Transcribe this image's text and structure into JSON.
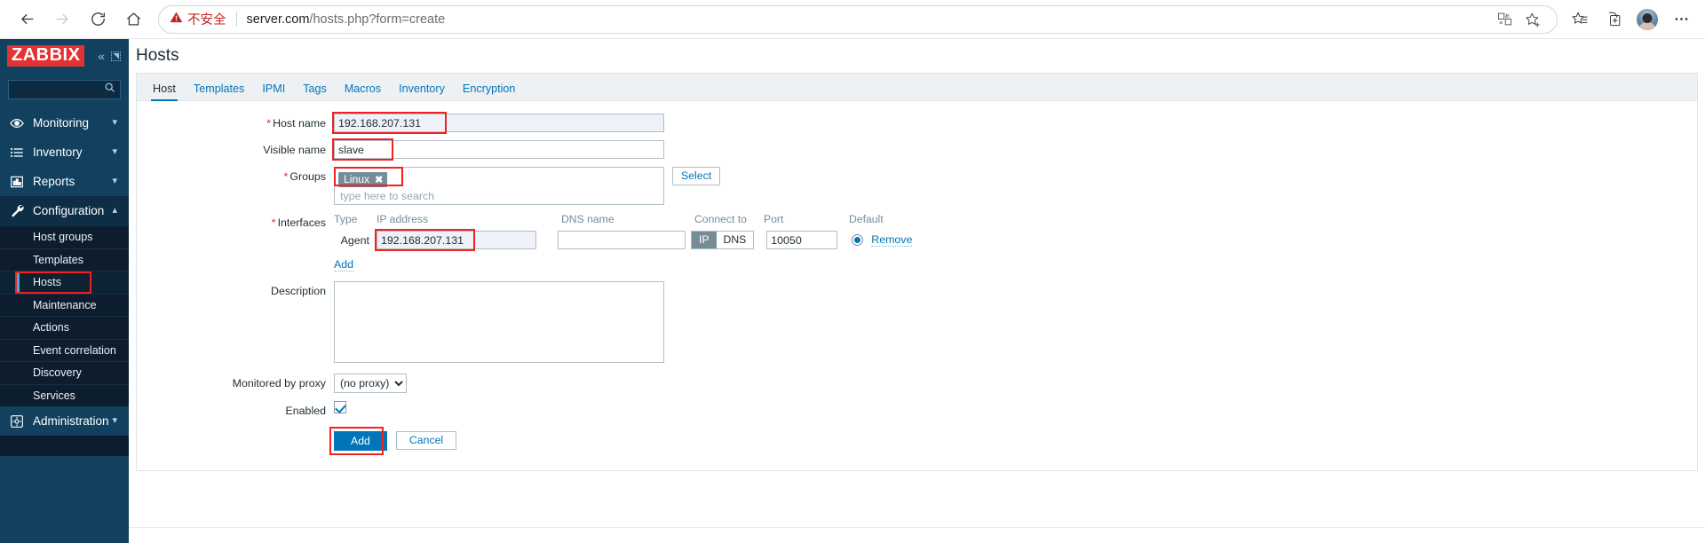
{
  "browser": {
    "back_icon": "arrow-left-icon",
    "forward_icon": "arrow-right-icon",
    "reload_icon": "reload-icon",
    "home_icon": "home-icon",
    "security_warning": "不安全",
    "warning_icon": "warning-triangle-icon",
    "url_host": "server.com",
    "url_path": "/hosts.php?form=create",
    "omnibox_icons": [
      "translate-ime-icon",
      "favorite-star-icon"
    ],
    "toolbar_icons": [
      "collections-icon",
      "split-screen-icon",
      "profile-avatar",
      "more-options-icon"
    ]
  },
  "sidebar": {
    "logo": "ZABBIX",
    "collapse_icon": "chevron-double-left-icon",
    "expand_icon": "expand-panel-icon",
    "search_placeholder": "",
    "search_icon": "search-icon",
    "items": [
      {
        "label": "Monitoring",
        "icon": "eye-icon",
        "caret": "chevron-down-icon"
      },
      {
        "label": "Inventory",
        "icon": "list-icon",
        "caret": "chevron-down-icon"
      },
      {
        "label": "Reports",
        "icon": "bar-chart-icon",
        "caret": "chevron-down-icon"
      },
      {
        "label": "Configuration",
        "icon": "wrench-icon",
        "caret": "chevron-up-icon"
      }
    ],
    "sub_items": [
      {
        "label": "Host groups"
      },
      {
        "label": "Templates"
      },
      {
        "label": "Hosts"
      },
      {
        "label": "Maintenance"
      },
      {
        "label": "Actions"
      },
      {
        "label": "Event correlation"
      },
      {
        "label": "Discovery"
      },
      {
        "label": "Services"
      }
    ],
    "selected_sub": "Hosts",
    "admin": {
      "label": "Administration",
      "icon": "gear-icon",
      "caret": "chevron-down-icon"
    }
  },
  "main": {
    "page_title": "Hosts",
    "tabs": [
      {
        "label": "Host",
        "active": true
      },
      {
        "label": "Templates",
        "active": false
      },
      {
        "label": "IPMI",
        "active": false
      },
      {
        "label": "Tags",
        "active": false
      },
      {
        "label": "Macros",
        "active": false
      },
      {
        "label": "Inventory",
        "active": false
      },
      {
        "label": "Encryption",
        "active": false
      }
    ]
  },
  "form": {
    "host_name": {
      "label": "Host name",
      "value": "192.168.207.131",
      "required": "*"
    },
    "visible_name": {
      "label": "Visible name",
      "value": "slave"
    },
    "groups": {
      "label": "Groups",
      "required": "*",
      "chip": "Linux",
      "chip_remove_icon": "close-icon",
      "placeholder": "type here to search",
      "select_button": "Select"
    },
    "interfaces": {
      "label": "Interfaces",
      "required": "*",
      "columns": [
        "Type",
        "IP address",
        "DNS name",
        "Connect to",
        "Port",
        "Default"
      ],
      "rows": [
        {
          "type": "Agent",
          "ip": "192.168.207.131",
          "dns": "",
          "connect_to_ip": "IP",
          "connect_to_dns": "DNS",
          "connect_selected": "IP",
          "port": "10050",
          "default_selected": true,
          "remove_link": "Remove"
        }
      ],
      "add_link": "Add"
    },
    "description": {
      "label": "Description",
      "value": ""
    },
    "proxy": {
      "label": "Monitored by proxy",
      "value": "(no proxy)",
      "options": [
        "(no proxy)"
      ]
    },
    "enabled": {
      "label": "Enabled",
      "checked": true
    },
    "buttons": {
      "submit": "Add",
      "cancel": "Cancel"
    }
  },
  "colors": {
    "zabbix_red": "#e33232",
    "sidebar_dark": "#0d1d2e",
    "sidebar_blue": "#11415f",
    "link_blue": "#0275b8",
    "highlight_red": "#f42020",
    "chip_gray": "#768d99"
  }
}
